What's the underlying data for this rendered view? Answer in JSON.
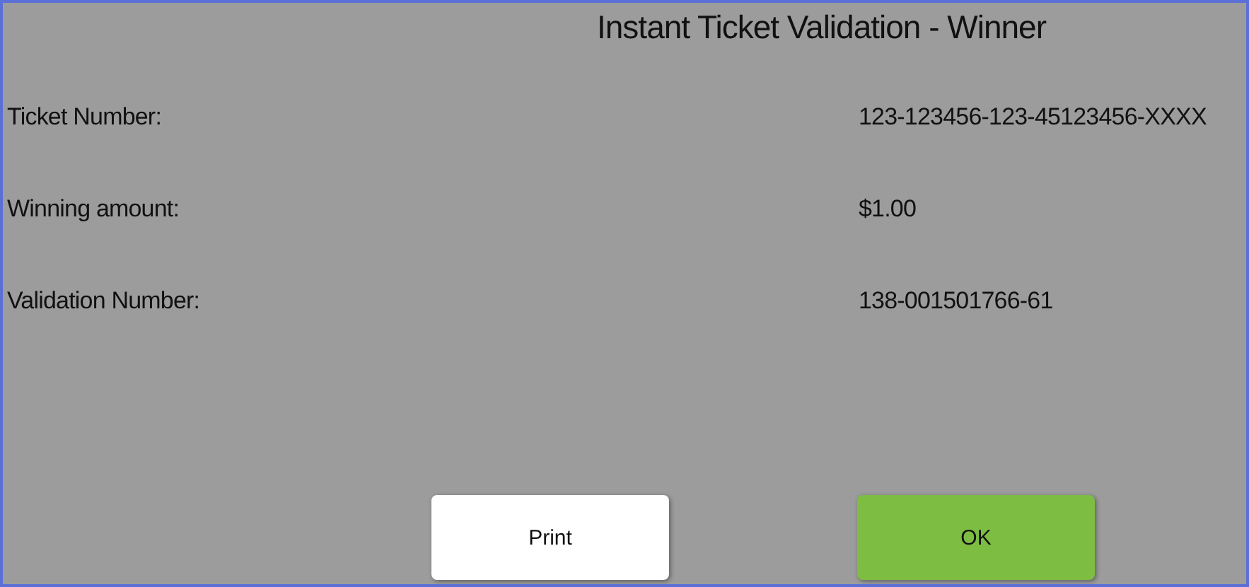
{
  "title": "Instant Ticket Validation - Winner",
  "fields": [
    {
      "label": "Ticket Number:",
      "value": "123-123456-123-45123456-XXXX"
    },
    {
      "label": "Winning amount:",
      "value": "$1.00"
    },
    {
      "label": "Validation Number:",
      "value": "138-001501766-61"
    }
  ],
  "buttons": [
    {
      "label": "Print",
      "kind": "secondary"
    },
    {
      "label": "OK",
      "kind": "primary"
    }
  ]
}
